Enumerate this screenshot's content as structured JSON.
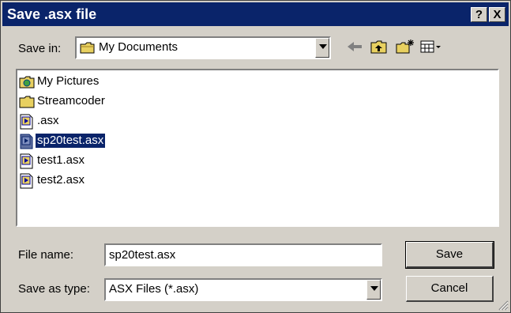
{
  "window": {
    "title": "Save .asx file",
    "help_glyph": "?",
    "close_glyph": "X"
  },
  "toolbar": {
    "save_in_label": "Save in:",
    "save_in_value": "My Documents",
    "icons": [
      "back-arrow-icon",
      "up-one-level-icon",
      "new-folder-icon",
      "views-menu-icon"
    ]
  },
  "files": [
    {
      "name": "My Pictures",
      "icon": "pictures-folder-icon",
      "selected": false
    },
    {
      "name": "Streamcoder",
      "icon": "folder-icon",
      "selected": false
    },
    {
      "name": ".asx",
      "icon": "asx-file-icon",
      "selected": false
    },
    {
      "name": "sp20test.asx",
      "icon": "asx-file-icon",
      "selected": true
    },
    {
      "name": "test1.asx",
      "icon": "asx-file-icon",
      "selected": false
    },
    {
      "name": "test2.asx",
      "icon": "asx-file-icon",
      "selected": false
    }
  ],
  "form": {
    "file_name_label": "File name:",
    "file_name_value": "sp20test.asx",
    "save_as_type_label": "Save as type:",
    "save_as_type_value": "ASX Files (*.asx)"
  },
  "buttons": {
    "save": "Save",
    "cancel": "Cancel"
  },
  "colors": {
    "titlebar": "#0a246a",
    "face": "#d4d0c8",
    "selection": "#0a246a"
  }
}
